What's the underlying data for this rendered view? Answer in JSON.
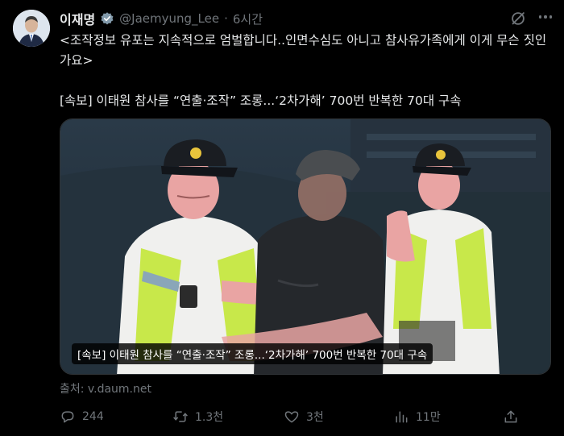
{
  "author": {
    "name": "이재명",
    "handle": "@Jaemyung_Lee",
    "separator": "·",
    "time": "6시간"
  },
  "tweet": {
    "line1": "<조작정보 유포는 지속적으로 엄벌합니다..인면수심도 아니고 참사유가족에게 이게 무슨 짓인가요>",
    "line2": "[속보] 이태원 참사를 “연출·조작” 조롱...‘2차가해’ 700번 반복한 70대 구속"
  },
  "card": {
    "caption": "[속보] 이태원 참사를 “연출·조작” 조롱...‘2차가해’ 700번 반복한 70대 구속",
    "source": "출처: v.daum.net"
  },
  "actions": {
    "replies": "244",
    "reposts": "1.3천",
    "likes": "3천",
    "views": "11만"
  },
  "icons": [
    "verified-badge-icon",
    "grok-icon",
    "more-icon",
    "reply-icon",
    "repost-icon",
    "like-icon",
    "views-icon",
    "share-icon"
  ],
  "colors": {
    "background": "#000000",
    "text": "#e7e9ea",
    "muted": "#71767b",
    "verified": "#1d9bf0"
  }
}
